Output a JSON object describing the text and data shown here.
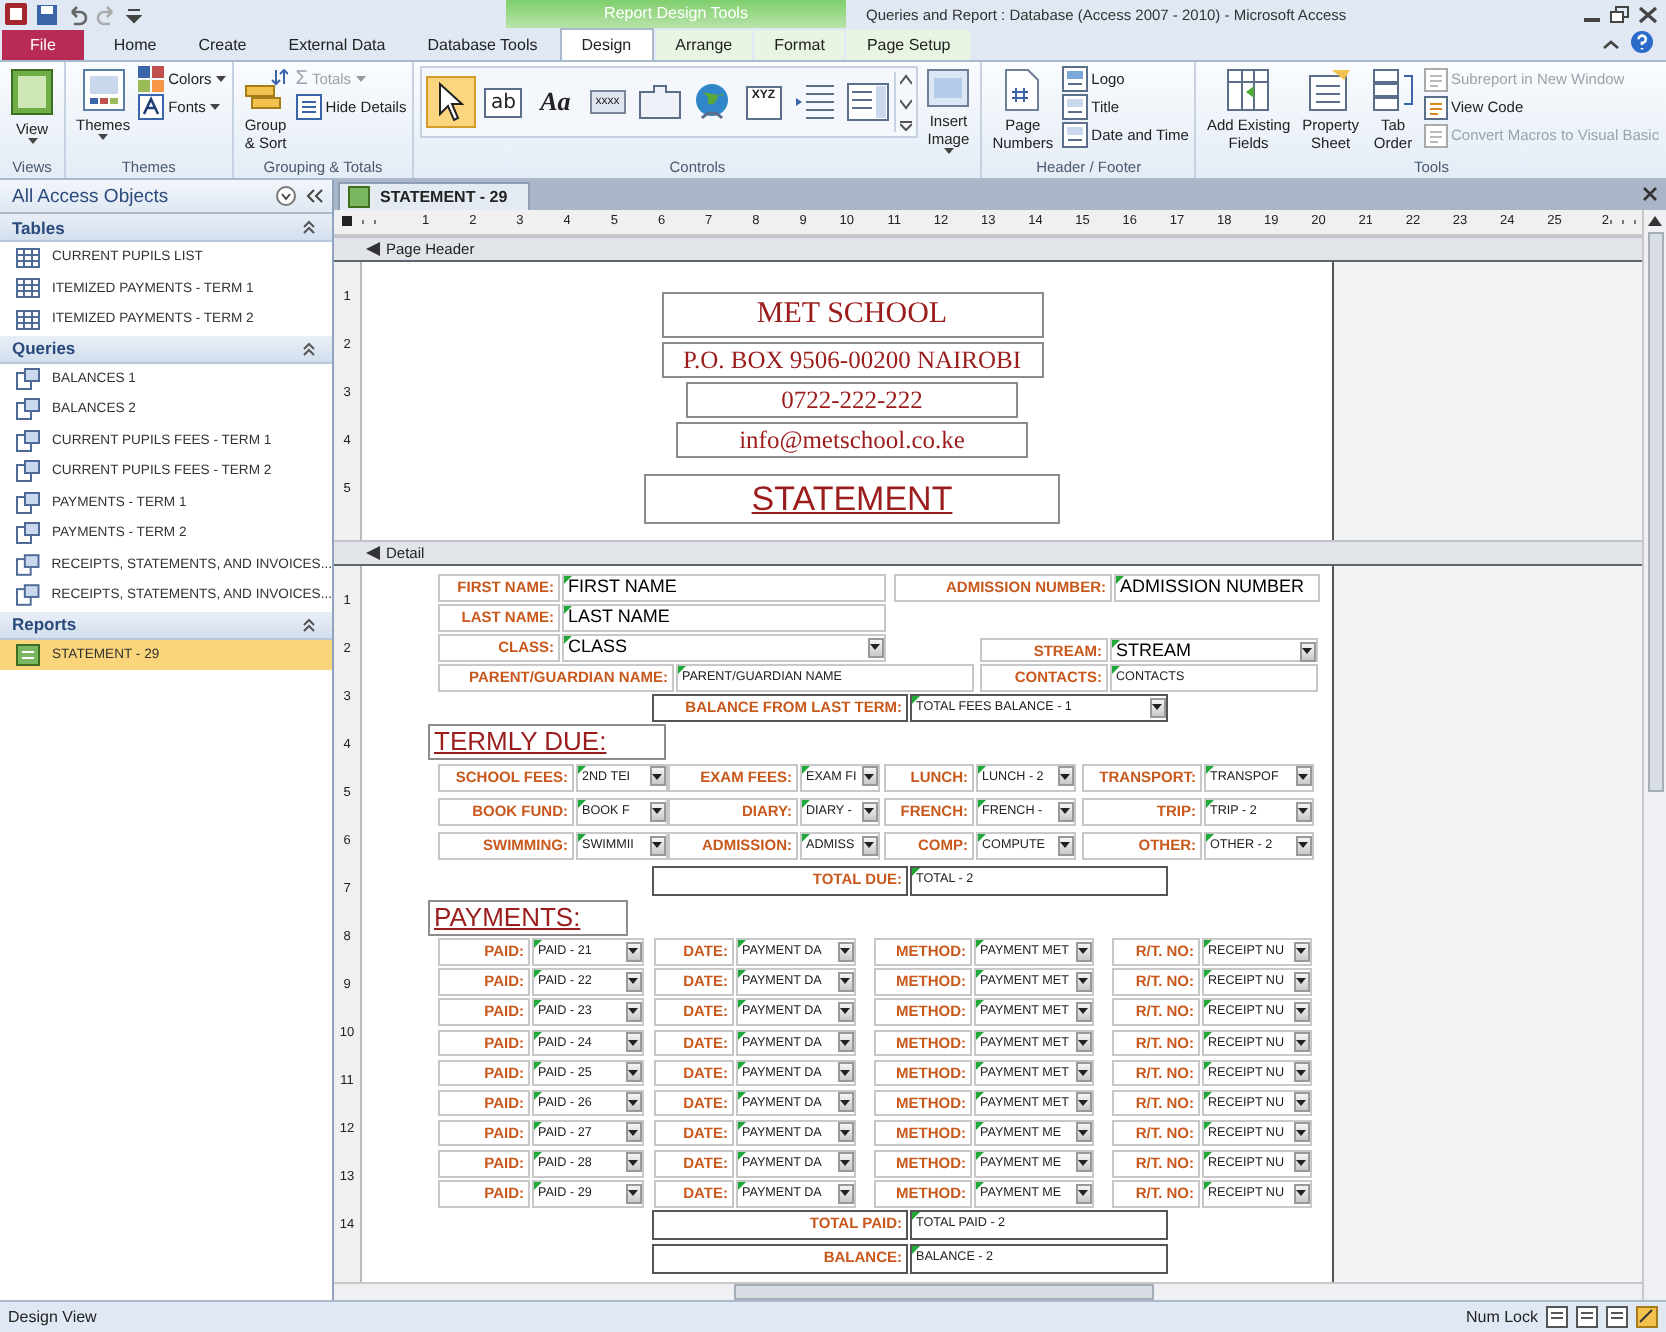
{
  "title_bar": {
    "context": "Report Design Tools",
    "title": "Queries and Report : Database (Access 2007 - 2010)  -  Microsoft Access"
  },
  "tabs": [
    {
      "label": "File",
      "kind": "file",
      "selected": false
    },
    {
      "label": "Home",
      "kind": "plain",
      "selected": false
    },
    {
      "label": "Create",
      "kind": "plain",
      "selected": false
    },
    {
      "label": "External Data",
      "kind": "plain",
      "selected": false
    },
    {
      "label": "Database Tools",
      "kind": "plain",
      "selected": false
    },
    {
      "label": "Design",
      "kind": "context",
      "selected": true
    },
    {
      "label": "Arrange",
      "kind": "context",
      "selected": false
    },
    {
      "label": "Format",
      "kind": "context",
      "selected": false
    },
    {
      "label": "Page Setup",
      "kind": "context",
      "selected": false
    }
  ],
  "ribbon": [
    {
      "group": "Views",
      "items": [
        {
          "lines": [
            "View"
          ],
          "disabled": false
        }
      ]
    },
    {
      "group": "Themes",
      "items": [
        {
          "lines": [
            "Themes"
          ],
          "disabled": false
        },
        {
          "lines": [
            "Colors"
          ],
          "disabled": false
        },
        {
          "lines": [
            "Fonts"
          ],
          "disabled": false
        }
      ]
    },
    {
      "group": "Grouping & Totals",
      "items": [
        {
          "lines": [
            "Group",
            "& Sort"
          ],
          "disabled": false
        },
        {
          "glyph": "Σ",
          "lines": [
            "Totals"
          ],
          "disabled": true
        },
        {
          "lines": [
            "Hide Details"
          ],
          "disabled": false
        }
      ]
    },
    {
      "group": "Controls",
      "gallery": [
        {
          "kind": "pointer",
          "selected": true
        },
        {
          "kind": "textbox",
          "text": "ab",
          "selected": false
        },
        {
          "kind": "label",
          "text": "Aa",
          "selected": false
        },
        {
          "kind": "button",
          "text": "xxxx",
          "selected": false
        },
        {
          "kind": "tab",
          "selected": false
        },
        {
          "kind": "globe",
          "selected": false
        },
        {
          "kind": "frame",
          "text": "XYZ",
          "selected": false
        },
        {
          "kind": "pagebreak",
          "selected": false
        },
        {
          "kind": "combo",
          "selected": false
        }
      ],
      "items": [
        {
          "lines": [
            "Insert",
            "Image"
          ],
          "disabled": false
        }
      ]
    },
    {
      "group": "Header / Footer",
      "items": [
        {
          "lines": [
            "Page",
            "Numbers"
          ],
          "disabled": false
        },
        {
          "lines": [
            "Logo"
          ],
          "disabled": false
        },
        {
          "lines": [
            "Title"
          ],
          "disabled": false
        },
        {
          "lines": [
            "Date and Time"
          ],
          "disabled": false
        }
      ]
    },
    {
      "group": "Tools",
      "items": [
        {
          "lines": [
            "Add Existing",
            "Fields"
          ],
          "disabled": false
        },
        {
          "lines": [
            "Property",
            "Sheet"
          ],
          "disabled": false
        },
        {
          "lines": [
            "Tab",
            "Order"
          ],
          "disabled": false
        },
        {
          "lines": [
            "Subreport in New Window"
          ],
          "disabled": true
        },
        {
          "lines": [
            "View Code"
          ],
          "disabled": false
        },
        {
          "lines": [
            "Convert Macros to Visual Basic"
          ],
          "disabled": true
        }
      ]
    }
  ],
  "navigation": {
    "title": "All Access Objects",
    "sections": [
      {
        "title": "Tables",
        "kind": "table",
        "items": [
          {
            "label": "CURRENT PUPILS LIST",
            "selected": false
          },
          {
            "label": "ITEMIZED PAYMENTS - TERM 1",
            "selected": false
          },
          {
            "label": "ITEMIZED PAYMENTS - TERM 2",
            "selected": false
          }
        ]
      },
      {
        "title": "Queries",
        "kind": "query",
        "items": [
          {
            "label": "BALANCES 1",
            "selected": false
          },
          {
            "label": "BALANCES 2",
            "selected": false
          },
          {
            "label": "CURRENT PUPILS FEES - TERM 1",
            "selected": false
          },
          {
            "label": "CURRENT PUPILS FEES - TERM 2",
            "selected": false
          },
          {
            "label": "PAYMENTS - TERM 1",
            "selected": false
          },
          {
            "label": "PAYMENTS - TERM 2",
            "selected": false
          },
          {
            "label": "RECEIPTS, STATEMENTS, AND INVOICES...",
            "selected": false
          },
          {
            "label": "RECEIPTS, STATEMENTS, AND INVOICES...",
            "selected": false
          }
        ]
      },
      {
        "title": "Reports",
        "kind": "report",
        "items": [
          {
            "label": "STATEMENT - 29",
            "selected": true
          }
        ]
      }
    ]
  },
  "document": {
    "tab": "STATEMENT - 29",
    "ruler": [
      "1",
      "2",
      "3",
      "4",
      "5",
      "6",
      "7",
      "8",
      "9",
      "10",
      "11",
      "12",
      "13",
      "14",
      "15",
      "16",
      "17",
      "18",
      "19",
      "20",
      "21",
      "22",
      "23",
      "24",
      "25",
      "2"
    ],
    "header": {
      "band": "Page Header",
      "ruler": [
        "1",
        "2",
        "3",
        "4",
        "5"
      ],
      "lines": [
        {
          "text": "MET SCHOOL",
          "kind": "name"
        },
        {
          "text": "P.O. BOX 9506-00200  NAIROBI",
          "kind": "line"
        },
        {
          "text": "0722-222-222",
          "kind": "line"
        },
        {
          "text": "info@metschool.co.ke",
          "kind": "line"
        },
        {
          "text": "STATEMENT",
          "kind": "heading"
        }
      ]
    },
    "detail": {
      "band": "Detail",
      "ruler": [
        "1",
        "2",
        "3",
        "4",
        "5",
        "6",
        "7",
        "8",
        "9",
        "10",
        "11",
        "12",
        "13",
        "14"
      ],
      "rows": [
        {
          "kind": "identity",
          "pairs": [
            {
              "label": "FIRST NAME:",
              "value": "FIRST NAME",
              "combo": false
            },
            {
              "label": "ADMISSION NUMBER:",
              "value": "ADMISSION NUMBER",
              "combo": false
            }
          ]
        },
        {
          "kind": "identity",
          "pairs": [
            {
              "label": "LAST NAME:",
              "value": "LAST NAME",
              "combo": false
            }
          ]
        },
        {
          "kind": "select",
          "pairs": [
            {
              "label": "CLASS:",
              "value": "CLASS",
              "combo": true
            },
            {
              "label": "STREAM:",
              "value": "STREAM",
              "combo": true
            }
          ]
        },
        {
          "kind": "contact",
          "pairs": [
            {
              "label": "PARENT/GUARDIAN NAME:",
              "value": "PARENT/GUARDIAN NAME",
              "combo": false
            },
            {
              "label": "CONTACTS:",
              "value": "CONTACTS",
              "combo": false
            }
          ]
        },
        {
          "kind": "center",
          "pairs": [
            {
              "label": "BALANCE FROM LAST TERM:",
              "value": "TOTAL FEES BALANCE - 1",
              "combo": true
            }
          ]
        },
        {
          "kind": "heading",
          "text": "TERMLY DUE:"
        },
        {
          "kind": "fees",
          "pairs": [
            {
              "label": "SCHOOL FEES:",
              "value": "2ND TEI",
              "combo": true
            },
            {
              "label": "EXAM FEES:",
              "value": "EXAM FI",
              "combo": true
            },
            {
              "label": "LUNCH:",
              "value": "LUNCH - 2",
              "combo": true
            },
            {
              "label": "TRANSPORT:",
              "value": "TRANSPOF",
              "combo": true
            }
          ]
        },
        {
          "kind": "fees",
          "pairs": [
            {
              "label": "BOOK FUND:",
              "value": "BOOK F",
              "combo": true
            },
            {
              "label": "DIARY:",
              "value": "DIARY -",
              "combo": true
            },
            {
              "label": "FRENCH:",
              "value": "FRENCH -",
              "combo": true
            },
            {
              "label": "TRIP:",
              "value": "TRIP - 2",
              "combo": true
            }
          ]
        },
        {
          "kind": "fees",
          "pairs": [
            {
              "label": "SWIMMING:",
              "value": "SWIMMII",
              "combo": true
            },
            {
              "label": "ADMISSION:",
              "value": "ADMISS",
              "combo": true
            },
            {
              "label": "COMP:",
              "value": "COMPUTE",
              "combo": true
            },
            {
              "label": "OTHER:",
              "value": "OTHER - 2",
              "combo": true
            }
          ]
        },
        {
          "kind": "total",
          "pairs": [
            {
              "label": "TOTAL  DUE:",
              "value": "TOTAL - 2",
              "combo": false
            }
          ]
        },
        {
          "kind": "heading",
          "text": "PAYMENTS:"
        },
        {
          "kind": "payment",
          "pairs": [
            {
              "label": "PAID:",
              "value": "PAID - 21",
              "combo": true
            },
            {
              "label": "DATE:",
              "value": "PAYMENT DA",
              "combo": true
            },
            {
              "label": "METHOD:",
              "value": "PAYMENT MET",
              "combo": true
            },
            {
              "label": "R/T. NO:",
              "value": "RECEIPT NU",
              "combo": true
            }
          ]
        },
        {
          "kind": "payment",
          "pairs": [
            {
              "label": "PAID:",
              "value": "PAID - 22",
              "combo": true
            },
            {
              "label": "DATE:",
              "value": "PAYMENT DA",
              "combo": true
            },
            {
              "label": "METHOD:",
              "value": "PAYMENT MET",
              "combo": true
            },
            {
              "label": "R/T. NO:",
              "value": "RECEIPT NU",
              "combo": true
            }
          ]
        },
        {
          "kind": "payment",
          "pairs": [
            {
              "label": "PAID:",
              "value": "PAID - 23",
              "combo": true
            },
            {
              "label": "DATE:",
              "value": "PAYMENT DA",
              "combo": true
            },
            {
              "label": "METHOD:",
              "value": "PAYMENT MET",
              "combo": true
            },
            {
              "label": "R/T. NO:",
              "value": "RECEIPT NU",
              "combo": true
            }
          ]
        },
        {
          "kind": "payment",
          "pairs": [
            {
              "label": "PAID:",
              "value": "PAID - 24",
              "combo": true
            },
            {
              "label": "DATE:",
              "value": "PAYMENT DA",
              "combo": true
            },
            {
              "label": "METHOD:",
              "value": "PAYMENT MET",
              "combo": true
            },
            {
              "label": "R/T. NO:",
              "value": "RECEIPT NU",
              "combo": true
            }
          ]
        },
        {
          "kind": "payment",
          "pairs": [
            {
              "label": "PAID:",
              "value": "PAID - 25",
              "combo": true
            },
            {
              "label": "DATE:",
              "value": "PAYMENT DA",
              "combo": true
            },
            {
              "label": "METHOD:",
              "value": "PAYMENT MET",
              "combo": true
            },
            {
              "label": "R/T. NO:",
              "value": "RECEIPT NU",
              "combo": true
            }
          ]
        },
        {
          "kind": "payment",
          "pairs": [
            {
              "label": "PAID:",
              "value": "PAID - 26",
              "combo": true
            },
            {
              "label": "DATE:",
              "value": "PAYMENT DA",
              "combo": true
            },
            {
              "label": "METHOD:",
              "value": "PAYMENT MET",
              "combo": true
            },
            {
              "label": "R/T. NO:",
              "value": "RECEIPT NU",
              "combo": true
            }
          ]
        },
        {
          "kind": "payment",
          "pairs": [
            {
              "label": "PAID:",
              "value": "PAID - 27",
              "combo": true
            },
            {
              "label": "DATE:",
              "value": "PAYMENT DA",
              "combo": true
            },
            {
              "label": "METHOD:",
              "value": "PAYMENT ME",
              "combo": true
            },
            {
              "label": "R/T. NO:",
              "value": "RECEIPT NU",
              "combo": true
            }
          ]
        },
        {
          "kind": "payment",
          "pairs": [
            {
              "label": "PAID:",
              "value": "PAID - 28",
              "combo": true
            },
            {
              "label": "DATE:",
              "value": "PAYMENT DA",
              "combo": true
            },
            {
              "label": "METHOD:",
              "value": "PAYMENT ME",
              "combo": true
            },
            {
              "label": "R/T. NO:",
              "value": "RECEIPT NU",
              "combo": true
            }
          ]
        },
        {
          "kind": "payment",
          "pairs": [
            {
              "label": "PAID:",
              "value": "PAID - 29",
              "combo": true
            },
            {
              "label": "DATE:",
              "value": "PAYMENT DA",
              "combo": true
            },
            {
              "label": "METHOD:",
              "value": "PAYMENT ME",
              "combo": true
            },
            {
              "label": "R/T. NO:",
              "value": "RECEIPT NU",
              "combo": true
            }
          ]
        },
        {
          "kind": "total",
          "pairs": [
            {
              "label": "TOTAL PAID:",
              "value": "TOTAL PAID - 2",
              "combo": false
            }
          ]
        },
        {
          "kind": "total",
          "pairs": [
            {
              "label": "BALANCE:",
              "value": "BALANCE - 2",
              "combo": false
            }
          ]
        }
      ]
    }
  },
  "status_bar": {
    "left": "Design View",
    "right": "Num Lock"
  }
}
